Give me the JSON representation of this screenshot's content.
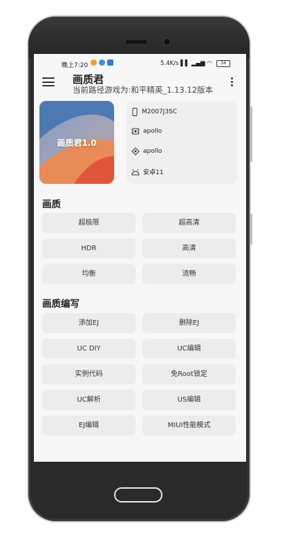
{
  "status_bar": {
    "time": "晚上7:20",
    "network": "5.4K/s",
    "battery": "34"
  },
  "app_bar": {
    "title": "画质君",
    "subtitle": "当前路径游戏为:和平精英_1.13.12版本",
    "menu_icon": "hamburger-menu-icon",
    "more_icon": "more-vertical-icon"
  },
  "cover": {
    "label": "画质君1.0"
  },
  "device_info": [
    {
      "icon": "phone-icon",
      "text": "M2007J3SC"
    },
    {
      "icon": "cpu-icon",
      "text": "apollo"
    },
    {
      "icon": "chip-icon",
      "text": "apollo"
    },
    {
      "icon": "android-icon",
      "text": "安卓11"
    }
  ],
  "section_quality": {
    "title": "画质",
    "buttons": [
      "超极限",
      "超高清",
      "HDR",
      "高清",
      "均衡",
      "流畅"
    ]
  },
  "section_edit": {
    "title": "画质编写",
    "buttons": [
      "添加EJ",
      "删除EJ",
      "UC DIY",
      "UC编辑",
      "实例代码",
      "免Root锁定",
      "UC解析",
      "US编辑",
      "EJ编辑",
      "MIUI性能模式"
    ]
  }
}
